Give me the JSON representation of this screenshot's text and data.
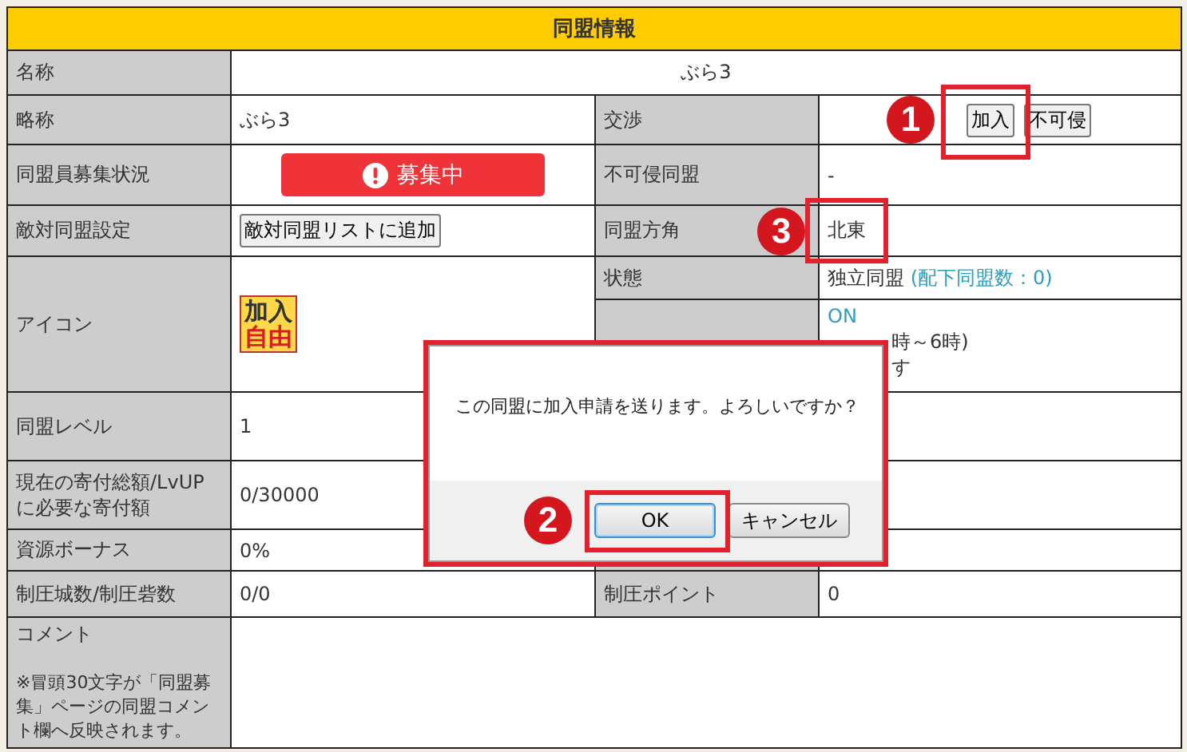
{
  "title": "同盟情報",
  "rows": [
    {
      "kind": "wide",
      "label": "名称",
      "value": "ぶら3"
    },
    {
      "kind": "split",
      "label": "略称",
      "value": {
        "kind": "text",
        "text": "ぶら3"
      },
      "label2": "交渉",
      "value2": {
        "kind": "buttons",
        "buttons": [
          {
            "label": "加入",
            "highlighted": true,
            "callout": "1"
          },
          {
            "label": "不可侵"
          }
        ]
      }
    },
    {
      "kind": "split",
      "label": "同盟員募集状況",
      "value": {
        "kind": "recruit",
        "text": "募集中"
      },
      "label2": "不可侵同盟",
      "value2": {
        "kind": "text",
        "text": "-"
      }
    },
    {
      "kind": "split",
      "label": "敵対同盟設定",
      "value": {
        "kind": "buttons",
        "buttons": [
          {
            "label": "敵対同盟リストに追加"
          }
        ]
      },
      "label2": "同盟方角",
      "value2": {
        "kind": "text",
        "text": "北東",
        "highlighted": true,
        "callout": "3"
      }
    },
    {
      "kind": "emblem",
      "label": "アイコン",
      "emblem": [
        "加入",
        "自由"
      ],
      "label2": "状態",
      "value2": {
        "kind": "status",
        "text": "独立同盟",
        "link": "(配下同盟数：0)"
      },
      "value3": {
        "kind": "lines",
        "lines": [
          "ON",
          "時～6時)",
          "す"
        ]
      }
    },
    {
      "kind": "split",
      "label": "同盟レベル",
      "value": {
        "kind": "text",
        "text": "1"
      }
    },
    {
      "kind": "split",
      "label": "現在の寄付総額/LvUPに必要な寄付額",
      "value": {
        "kind": "text",
        "text": "0/30000"
      }
    },
    {
      "kind": "split",
      "label": "資源ボーナス",
      "value": {
        "kind": "text",
        "text": "0%"
      }
    },
    {
      "kind": "split",
      "label": "制圧城数/制圧砦数",
      "value": {
        "kind": "text",
        "text": "0/0"
      },
      "label2": "制圧ポイント",
      "value2": {
        "kind": "text",
        "text": "0"
      }
    },
    {
      "kind": "comment",
      "label": "コメント",
      "note": "※冒頭30文字が「同盟募集」ページの同盟コメント欄へ反映されます。"
    }
  ],
  "dialog": {
    "message": "この同盟に加入申請を送ります。よろしいですか？",
    "highlighted": true,
    "buttons": [
      {
        "label": "OK",
        "focused": true,
        "highlighted": true,
        "callout": "2"
      },
      {
        "label": "キャンセル",
        "focused": false
      }
    ]
  }
}
